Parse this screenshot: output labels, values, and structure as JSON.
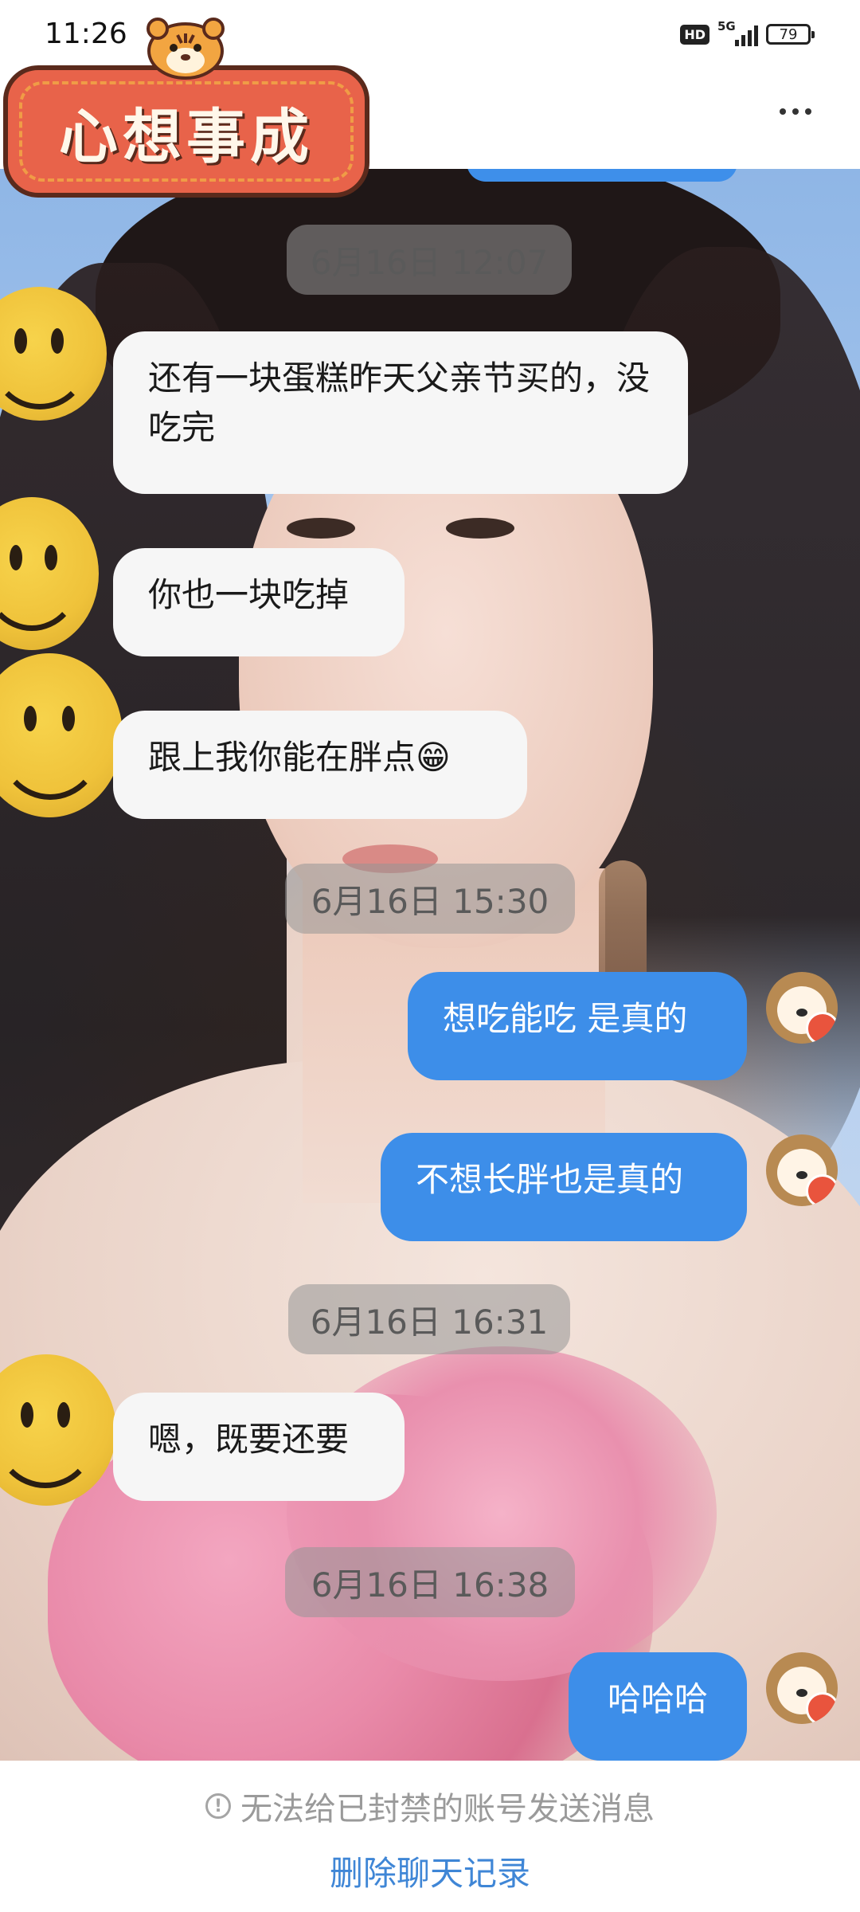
{
  "status_bar": {
    "time": "11:26",
    "network": "5G",
    "hd": "HD",
    "battery": "79"
  },
  "header": {
    "sticker_text": "心想事成",
    "more_icon": "more-icon"
  },
  "messages": [
    {
      "type": "timestamp",
      "text": "6月16日 12:07"
    },
    {
      "type": "incoming",
      "text": "还有一块蛋糕昨天父亲节买的，没吃完"
    },
    {
      "type": "incoming",
      "text": "你也一块吃掉"
    },
    {
      "type": "incoming",
      "text": "跟上我你能在胖点😁"
    },
    {
      "type": "timestamp",
      "text": "6月16日 15:30"
    },
    {
      "type": "outgoing",
      "text": "想吃能吃 是真的"
    },
    {
      "type": "outgoing",
      "text": "不想长胖也是真的"
    },
    {
      "type": "timestamp",
      "text": "6月16日 16:31"
    },
    {
      "type": "incoming",
      "text": "嗯，既要还要"
    },
    {
      "type": "timestamp",
      "text": "6月16日 16:38"
    },
    {
      "type": "outgoing",
      "text": "哈哈哈"
    }
  ],
  "footer": {
    "notice": "无法给已封禁的账号发送消息",
    "delete_link": "删除聊天记录"
  },
  "colors": {
    "outgoing_bubble": "#3d8ee9",
    "incoming_bubble": "#f6f6f6",
    "link": "#3f86d6"
  }
}
